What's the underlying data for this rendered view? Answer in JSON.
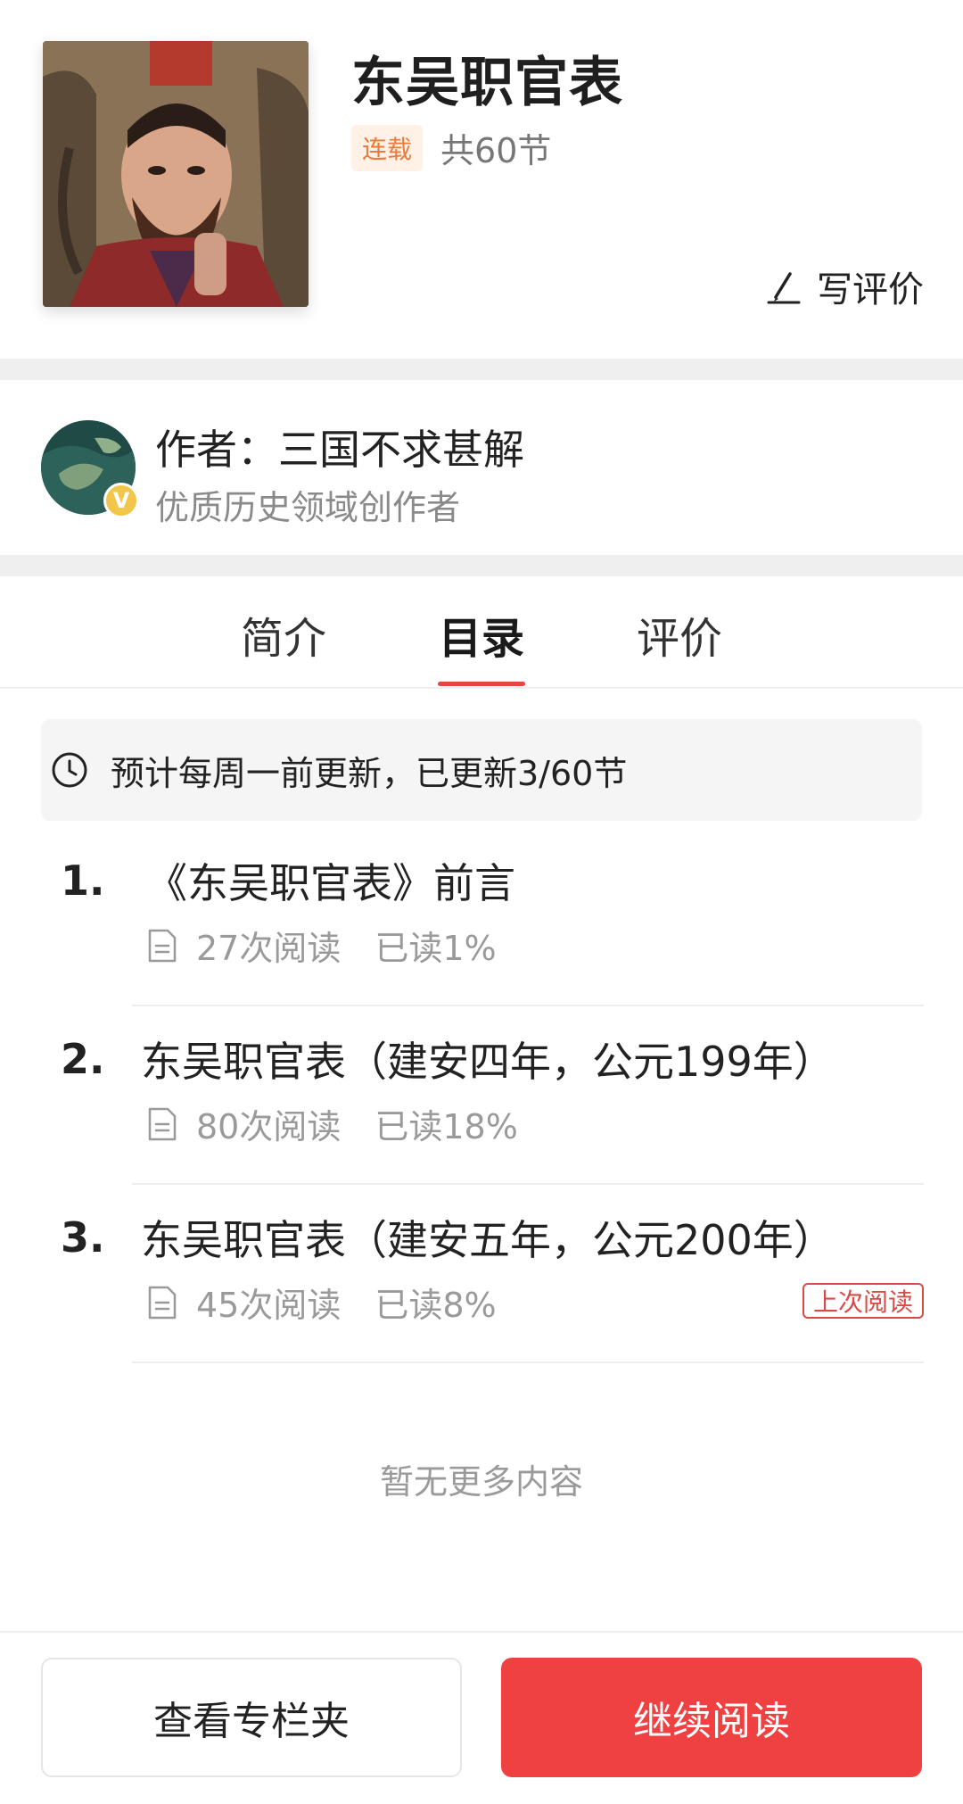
{
  "book": {
    "title": "东吴职官表",
    "status_badge": "连载",
    "sections_count": "共60节",
    "write_review_label": "写评价"
  },
  "author": {
    "name_line": "作者：三国不求甚解",
    "description": "优质历史领域创作者",
    "verified_badge": "V"
  },
  "tabs": [
    {
      "label": "简介",
      "active": false
    },
    {
      "label": "目录",
      "active": true
    },
    {
      "label": "评价",
      "active": false
    }
  ],
  "update_notice": "预计每周一前更新，已更新3/60节",
  "chapters": [
    {
      "num": "1.",
      "title": "《东吴职官表》前言",
      "reads": "27次阅读",
      "progress": "已读1%",
      "last_read": ""
    },
    {
      "num": "2.",
      "title": "东吴职官表（建安四年，公元199年）",
      "reads": "80次阅读",
      "progress": "已读18%",
      "last_read": ""
    },
    {
      "num": "3.",
      "title": "东吴职官表（建安五年，公元200年）",
      "reads": "45次阅读",
      "progress": "已读8%",
      "last_read": "上次阅读"
    }
  ],
  "no_more": "暂无更多内容",
  "bottom": {
    "folder_button": "查看专栏夹",
    "continue_button": "继续阅读"
  },
  "colors": {
    "accent_red": "#f04142",
    "badge_orange": "#ec7a3b",
    "verified_gold": "#f2c64a"
  },
  "icons": {
    "write": "pen-icon",
    "update": "clock-icon",
    "chapter": "document-icon"
  }
}
